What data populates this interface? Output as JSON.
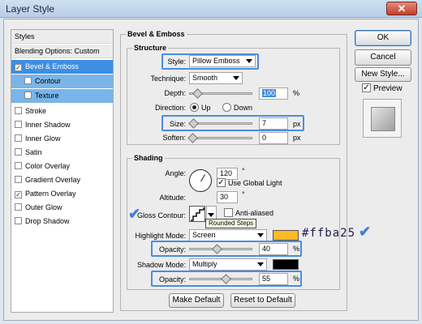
{
  "window": {
    "title": "Layer Style",
    "close_glyph": "✕"
  },
  "styles_panel": {
    "header": "Styles",
    "blending": "Blending Options: Custom",
    "items": [
      {
        "label": "Bevel & Emboss",
        "checked": "✓"
      },
      {
        "label": "Contour",
        "checked": ""
      },
      {
        "label": "Texture",
        "checked": ""
      },
      {
        "label": "Stroke",
        "checked": ""
      },
      {
        "label": "Inner Shadow",
        "checked": ""
      },
      {
        "label": "Inner Glow",
        "checked": ""
      },
      {
        "label": "Satin",
        "checked": ""
      },
      {
        "label": "Color Overlay",
        "checked": ""
      },
      {
        "label": "Gradient Overlay",
        "checked": ""
      },
      {
        "label": "Pattern Overlay",
        "checked": "✓"
      },
      {
        "label": "Outer Glow",
        "checked": ""
      },
      {
        "label": "Drop Shadow",
        "checked": ""
      }
    ]
  },
  "bevel": {
    "title": "Bevel & Emboss",
    "structure": {
      "title": "Structure",
      "style_label": "Style:",
      "style_value": "Pillow Emboss",
      "technique_label": "Technique:",
      "technique_value": "Smooth",
      "depth_label": "Depth:",
      "depth_value": "100",
      "depth_unit": "%",
      "direction_label": "Direction:",
      "direction_up": "Up",
      "direction_down": "Down",
      "size_label": "Size:",
      "size_value": "7",
      "size_unit": "px",
      "soften_label": "Soften:",
      "soften_value": "0",
      "soften_unit": "px"
    },
    "shading": {
      "title": "Shading",
      "angle_label": "Angle:",
      "angle_value": "120",
      "angle_unit": "°",
      "global_light": "Use Global Light",
      "altitude_label": "Altitude:",
      "altitude_value": "30",
      "altitude_unit": "°",
      "gloss_label": "Gloss Contour:",
      "anti_aliased": "Anti-aliased",
      "tooltip": "Rounded Steps",
      "highlight_mode_label": "Highlight Mode:",
      "highlight_mode_value": "Screen",
      "highlight_color": "#ffba25",
      "opacity_label": "Opacity:",
      "highlight_opacity": "40",
      "opacity_unit": "%",
      "shadow_mode_label": "Shadow Mode:",
      "shadow_mode_value": "Multiply",
      "shadow_color": "#000000",
      "shadow_opacity": "55"
    },
    "make_default": "Make Default",
    "reset_default": "Reset to Default"
  },
  "annotation": {
    "hex": "#ffba25",
    "check": "✔"
  },
  "right": {
    "ok": "OK",
    "cancel": "Cancel",
    "new_style": "New Style...",
    "preview": "Preview"
  }
}
